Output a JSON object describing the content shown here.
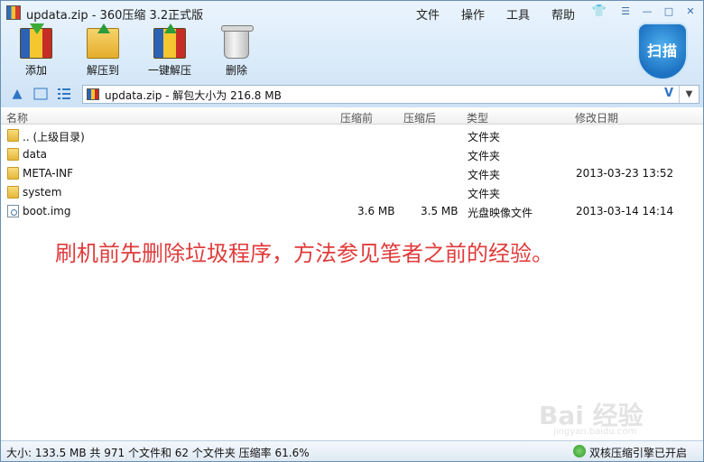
{
  "window": {
    "title": "updata.zip - 360压缩 3.2正式版"
  },
  "menu": [
    "文件",
    "操作",
    "工具",
    "帮助"
  ],
  "window_buttons": {
    "skin": "👕",
    "menu": "☰",
    "minimize": "—",
    "maximize": "□",
    "close": "✕"
  },
  "toolbar": [
    {
      "label": "添加",
      "icon": "add-archive-icon"
    },
    {
      "label": "解压到",
      "icon": "extract-to-icon"
    },
    {
      "label": "一键解压",
      "icon": "one-click-extract-icon"
    },
    {
      "label": "删除",
      "icon": "trash-can-icon"
    }
  ],
  "scan": {
    "label": "扫描"
  },
  "nav": {
    "up_icon": "▲",
    "path": "updata.zip - 解包大小为 216.8 MB",
    "path_check": "V",
    "dropdown": "▼"
  },
  "columns": {
    "name": "名称",
    "compressed": "压缩前",
    "after": "压缩后",
    "type": "类型",
    "modified": "修改日期"
  },
  "rows": [
    {
      "name": ".. (上级目录)",
      "compressed": "",
      "after": "",
      "type": "文件夹",
      "modified": "",
      "kind": "folder"
    },
    {
      "name": "data",
      "compressed": "",
      "after": "",
      "type": "文件夹",
      "modified": "",
      "kind": "folder"
    },
    {
      "name": "META-INF",
      "compressed": "",
      "after": "",
      "type": "文件夹",
      "modified": "2013-03-23 13:52",
      "kind": "folder"
    },
    {
      "name": "system",
      "compressed": "",
      "after": "",
      "type": "文件夹",
      "modified": "",
      "kind": "folder"
    },
    {
      "name": "boot.img",
      "compressed": "3.6 MB",
      "after": "3.5 MB",
      "type": "光盘映像文件",
      "modified": "2013-03-14 14:14",
      "kind": "file"
    }
  ],
  "annotation": "刷机前先删除垃圾程序，方法参见笔者之前的经验。",
  "watermark": {
    "main": "Bai 经验",
    "sub": "jingyan.baidu.com"
  },
  "status": {
    "left": "大小: 133.5 MB 共 971 个文件和 62 个文件夹 压缩率 61.6%",
    "right": "双核压缩引擎已开启"
  },
  "colors": {
    "accent": "#2f76c6",
    "annotation": "#e03b3b",
    "scan": "#1d72c2"
  }
}
